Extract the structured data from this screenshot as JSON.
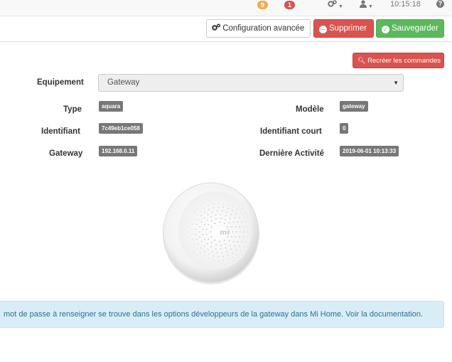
{
  "navbar": {
    "badge_orange": "9",
    "badge_red": "1",
    "time": "10:15:18",
    "help": "?"
  },
  "actions": {
    "config_label": "Configuration avancée",
    "delete_label": "Supprimer",
    "save_label": "Sauvegarder",
    "recreate_label": "Recréer les commandes"
  },
  "form": {
    "equipement_label": "Equipement",
    "equipement_value": "Gateway",
    "type_label": "Type",
    "type_value": "aquara",
    "modele_label": "Modèle",
    "modele_value": "gateway",
    "identifiant_label": "Identifiant",
    "identifiant_value": "7c49eb1ce058",
    "identifiant_court_label": "Identifiant court",
    "identifiant_court_value": "0",
    "gateway_label": "Gateway",
    "gateway_value": "192.168.0.11",
    "derniere_activite_label": "Dernière Activité",
    "derniere_activite_value": "2019-06-01 10:13:33"
  },
  "alert": {
    "text": "mot de passe à renseigner se trouve dans les options développeurs de la gateway dans Mi Home. Voir la documentation."
  },
  "colors": {
    "danger": "#d9534f",
    "success": "#5cb85c",
    "badge_warning": "#f0ad4e",
    "info_bg": "#d9edf7"
  }
}
